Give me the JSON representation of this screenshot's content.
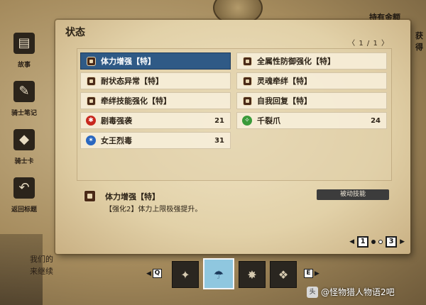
{
  "background": {
    "side_menu": [
      {
        "label": "故事",
        "icon": "story-book-icon",
        "glyph": "▤"
      },
      {
        "label": "骑士笔记",
        "icon": "knight-notes-icon",
        "glyph": "✎"
      },
      {
        "label": "骑士卡",
        "icon": "knight-card-icon",
        "glyph": "◆"
      },
      {
        "label": "返回标题",
        "icon": "return-title-icon",
        "glyph": "↶"
      }
    ],
    "money_label": "持有金额",
    "right_partial": "获得",
    "bottom_partial_line1": "我们的",
    "bottom_partial_line2": "来继续"
  },
  "panel": {
    "title": "状态",
    "pager": {
      "prev": "〈",
      "current": "1",
      "sep": "/",
      "total": "1",
      "next": "〉"
    }
  },
  "skills": [
    {
      "name": "体力增强【特】",
      "icon": "shield-skill-icon",
      "level": "",
      "selected": true
    },
    {
      "name": "全属性防御强化【特】",
      "icon": "shield-skill-icon",
      "level": "",
      "selected": false
    },
    {
      "name": "耐状态异常【特】",
      "icon": "shield-skill-icon",
      "level": "",
      "selected": false
    },
    {
      "name": "灵魂牵绊【特】",
      "icon": "shield-skill-icon",
      "level": "",
      "selected": false
    },
    {
      "name": "牵绊技能强化【特】",
      "icon": "shield-skill-icon",
      "level": "",
      "selected": false
    },
    {
      "name": "自我回复【特】",
      "icon": "shield-skill-icon",
      "level": "",
      "selected": false
    },
    {
      "name": "剧毒强袭",
      "icon": "red-attack-icon",
      "level": "21",
      "selected": false
    },
    {
      "name": "千裂爪",
      "icon": "green-claw-icon",
      "level": "24",
      "selected": false
    },
    {
      "name": "女王烈毒",
      "icon": "blue-poison-icon",
      "level": "31",
      "selected": false
    }
  ],
  "description": {
    "title": "体力增强【特】",
    "text": "【强化2】体力上限极强提升。",
    "tag": "被动技能"
  },
  "page_switch": {
    "left": "1",
    "right": "3"
  },
  "characters": {
    "prev_key": "Q",
    "next_key": "E",
    "portraits": [
      {
        "name": "rider-portrait",
        "glyph": "✦"
      },
      {
        "name": "monstie-portrait-selected",
        "glyph": "☂"
      },
      {
        "name": "monstie-portrait-3",
        "glyph": "✸"
      },
      {
        "name": "monstie-portrait-4",
        "glyph": "❖"
      }
    ]
  },
  "watermark": {
    "logo": "头",
    "text": "@怪物猎人物语2吧"
  },
  "colors": {
    "selected_row": "#2f5a86",
    "parchment": "#e2d1a8",
    "red_icon": "#c8281e",
    "blue_icon": "#2a67c0",
    "green_icon": "#3a9a3a"
  }
}
